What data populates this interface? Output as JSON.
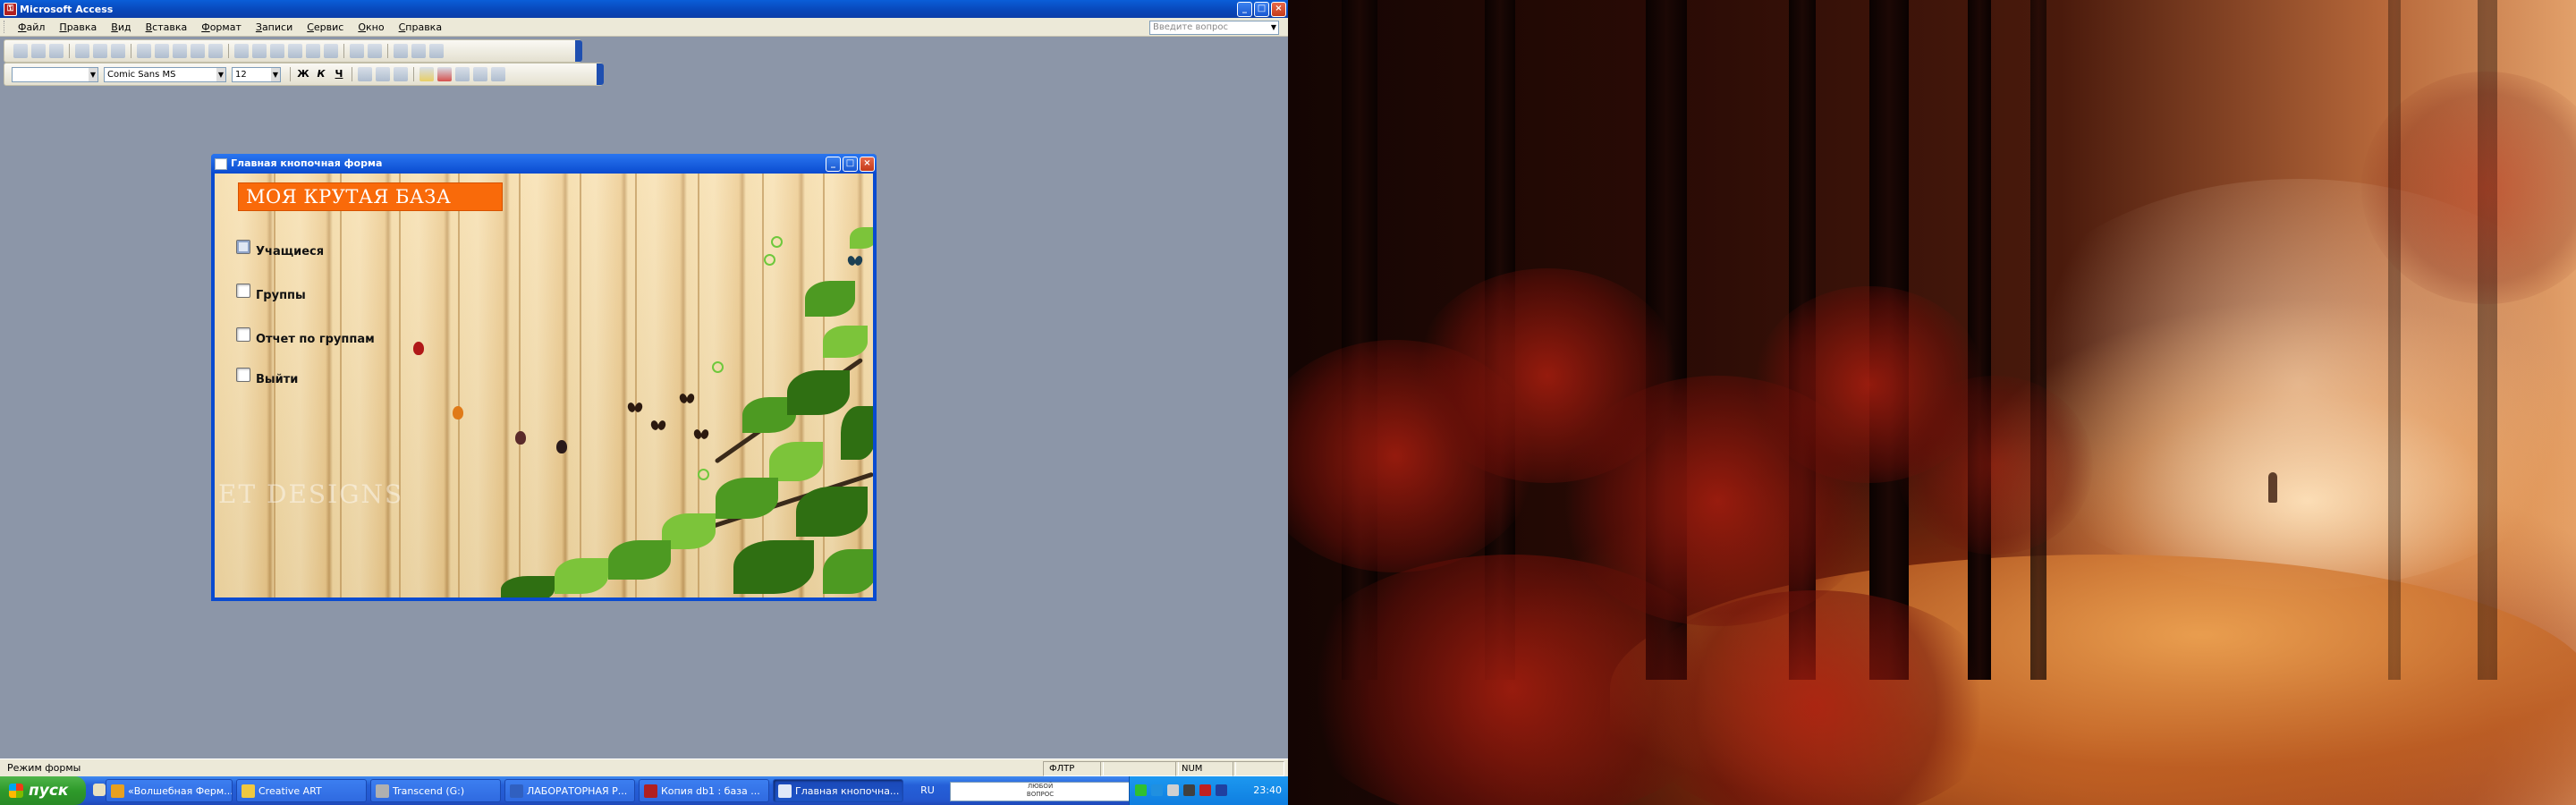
{
  "app": {
    "title": "Microsoft Access"
  },
  "menu": {
    "items": [
      "Файл",
      "Правка",
      "Вид",
      "Вставка",
      "Формат",
      "Записи",
      "Сервис",
      "Окно",
      "Справка"
    ],
    "help_placeholder": "Введите вопрос"
  },
  "formatting": {
    "object_value": "",
    "font": "Comic Sans MS",
    "size": "12",
    "bold": "Ж",
    "italic": "К",
    "underline": "Ч"
  },
  "form_window": {
    "title": "Главная кнопочная форма",
    "header": "МОЯ КРУТАЯ БАЗА",
    "items": [
      {
        "label": "Учащиеся"
      },
      {
        "label": "Группы"
      },
      {
        "label": "Отчет по группам"
      },
      {
        "label": "Выйти"
      }
    ],
    "watermark": "ET DESIGNS"
  },
  "statusbar": {
    "text": "Режим формы",
    "mode": "ФЛТР",
    "num": "NUM"
  },
  "taskbar": {
    "start_label": "пуск",
    "tasks": [
      {
        "label": "«Волшебная Ферм..."
      },
      {
        "label": "Creative ART"
      },
      {
        "label": "Transcend (G:)"
      },
      {
        "label": "ЛАБОРАТОРНАЯ Р..."
      },
      {
        "label": "Копия db1 : база ..."
      },
      {
        "label": "Главная кнопочна..."
      }
    ],
    "lang": "RU",
    "ad_line1": "ЛЮБОЙ",
    "ad_line2": "ВОПРОС",
    "clock": "23:40"
  },
  "colors": {
    "header_orange": "#f96a0a",
    "title_blue": "#0a4bd0",
    "desktop_gray": "#8c96a8",
    "taskbar_blue": "#2458d0",
    "start_green": "#2e9a2a"
  }
}
